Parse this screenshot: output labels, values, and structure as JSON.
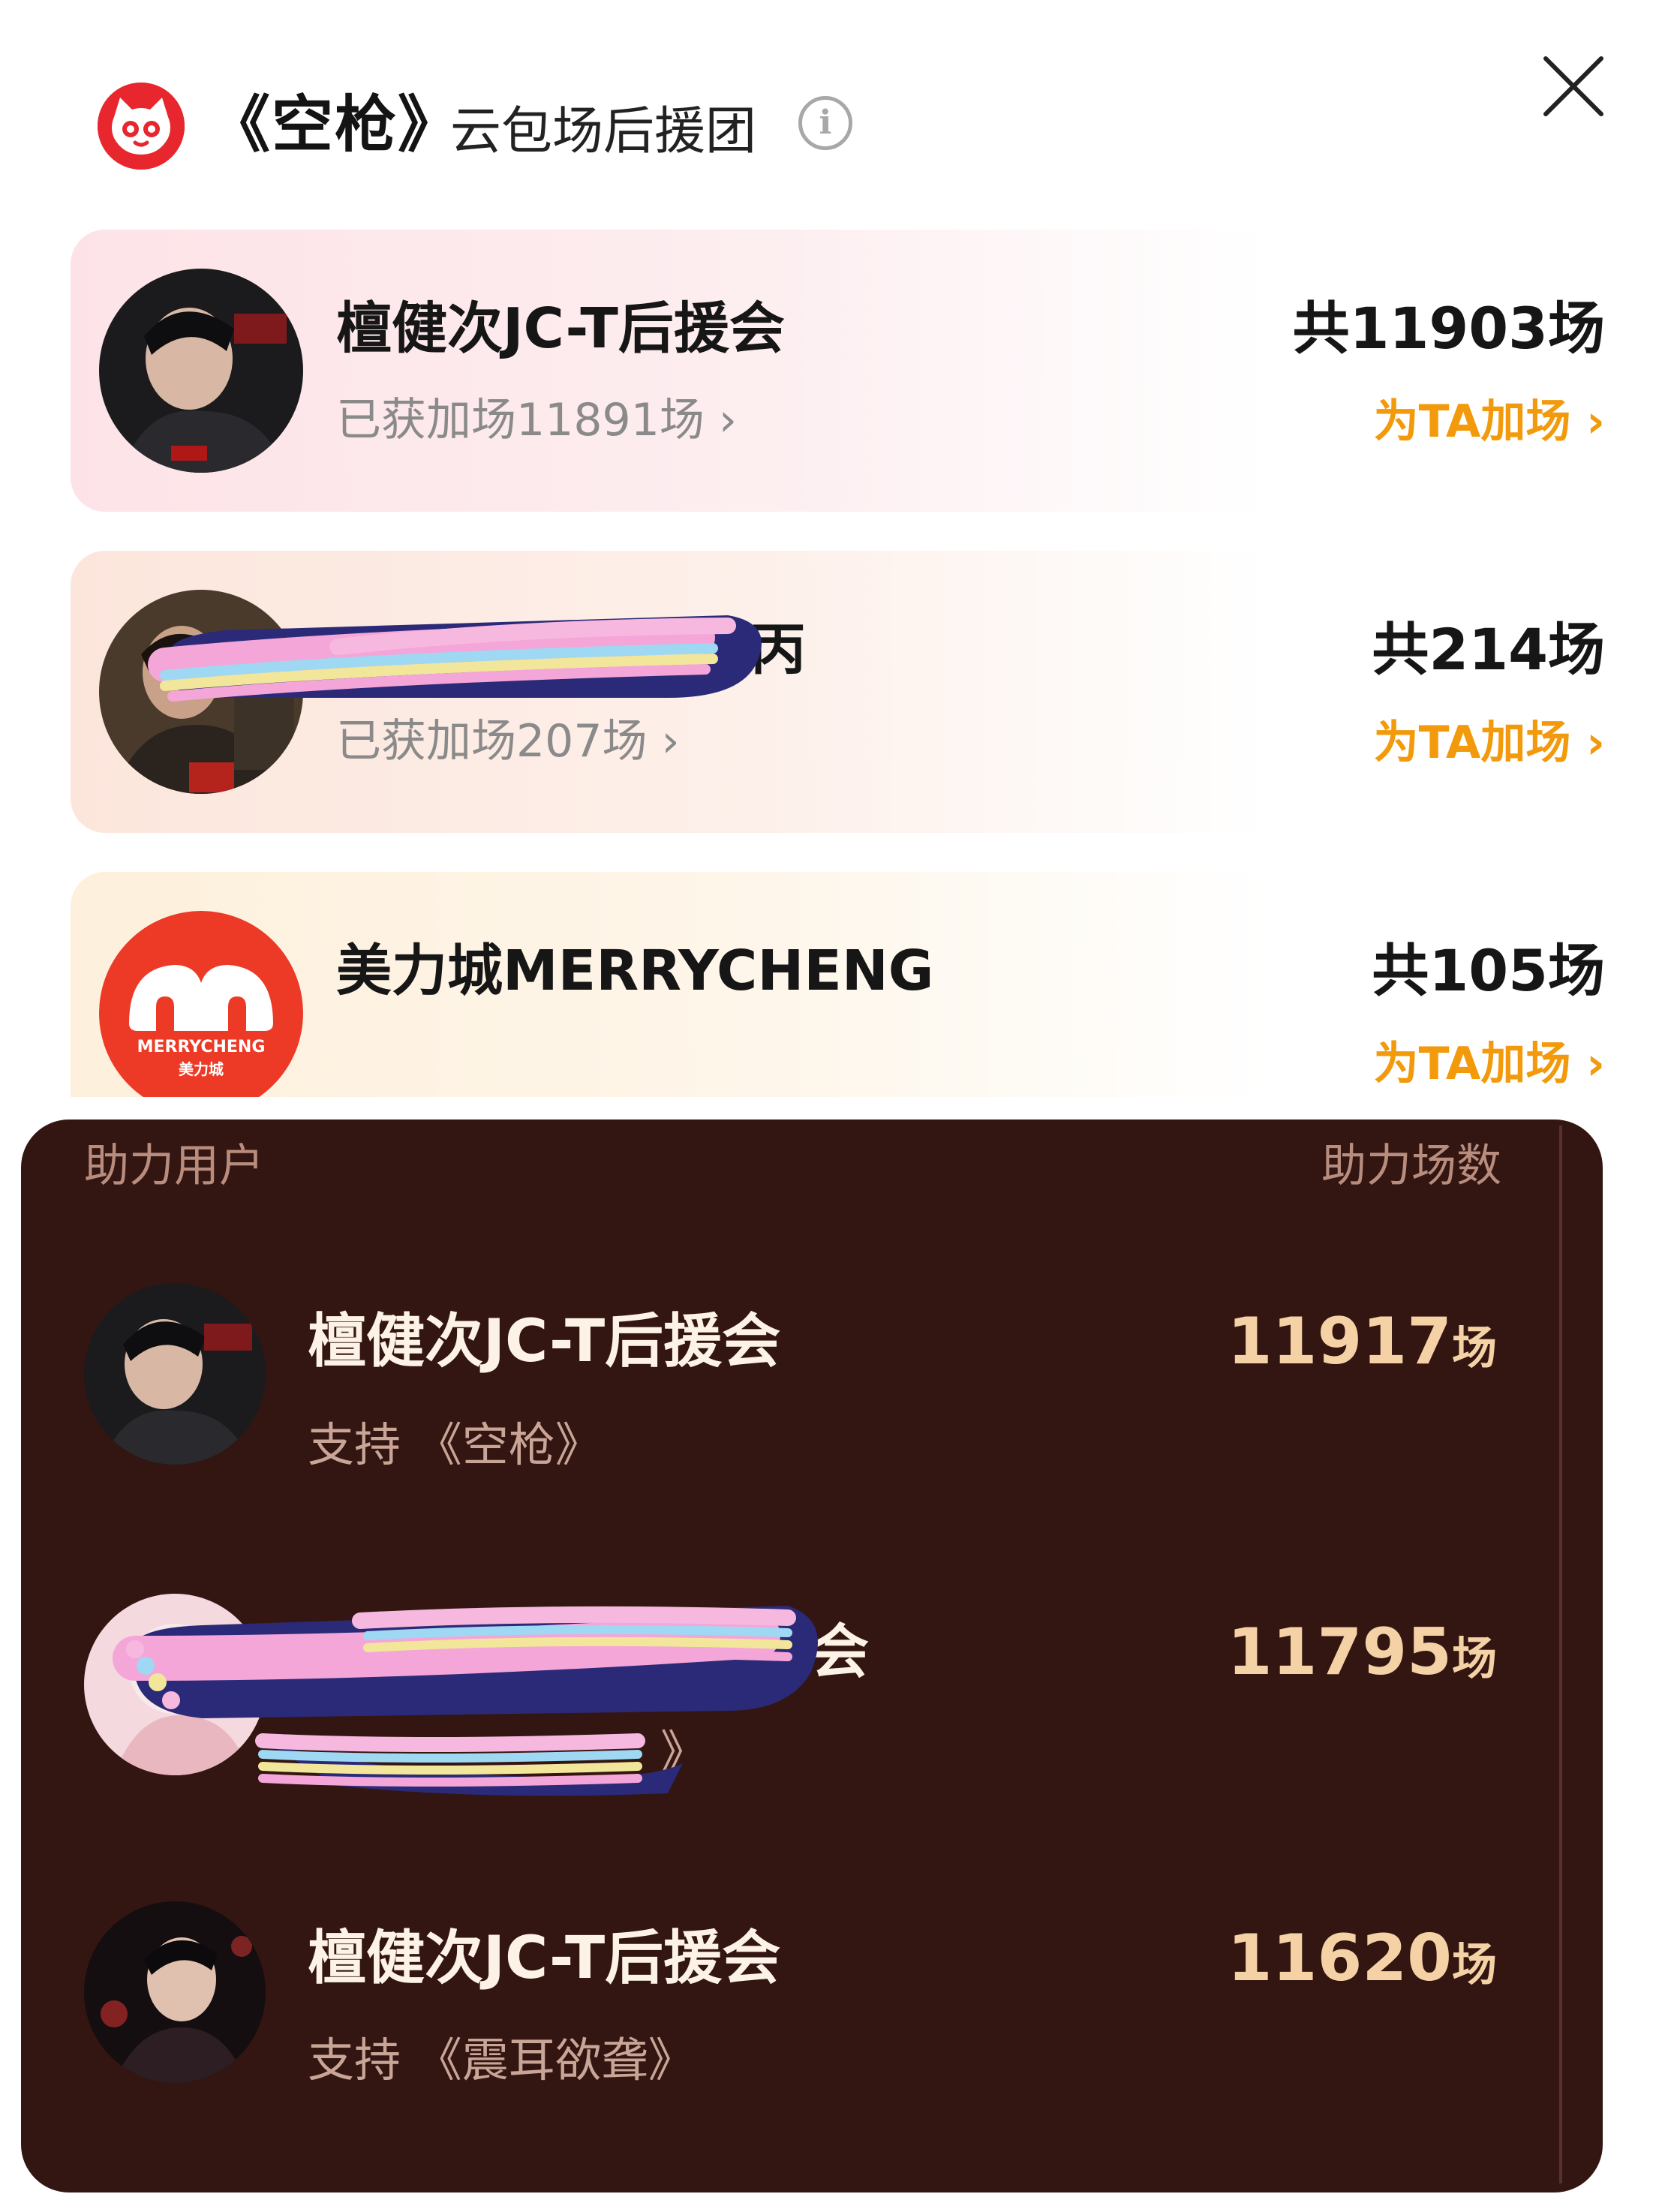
{
  "header": {
    "title": "《空枪》",
    "subtitle": "云包场后援团",
    "info_icon": "info-icon",
    "close_icon": "close-icon",
    "brand_color": "#e8262e"
  },
  "cards": [
    {
      "name": "檀健次JC-T后援会",
      "added": "已获加场11891场",
      "total": "共11903场",
      "link": "为TA加场"
    },
    {
      "name_visible": "丙",
      "added": "已获加场207场",
      "total": "共214场",
      "link": "为TA加场"
    },
    {
      "name": "美力城MERRYCHENG",
      "total": "共105场",
      "link": "为TA加场",
      "logo_text": "MERRYCHENG",
      "logo_subtext": "美力城"
    }
  ],
  "panel": {
    "col_left": "助力用户",
    "col_right": "助力场数",
    "rows": [
      {
        "name": "檀健次JC-T后援会",
        "support": "支持 《空枪》",
        "count": "11917",
        "unit": "场"
      },
      {
        "name_visible": "会",
        "support_visible": "》",
        "count": "11795",
        "unit": "场"
      },
      {
        "name": "檀健次JC-T后援会",
        "support": "支持 《震耳欲聋》",
        "count": "11620",
        "unit": "场"
      }
    ]
  },
  "colors": {
    "accent_orange": "#f29a0c",
    "panel_bg": "#331511",
    "count_gold": "#f4d2a6"
  }
}
